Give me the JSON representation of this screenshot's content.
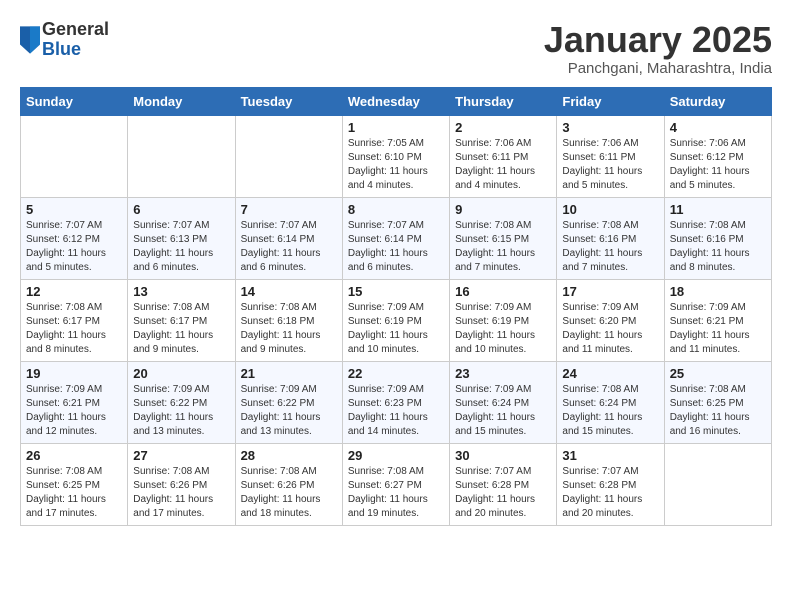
{
  "header": {
    "logo": {
      "general": "General",
      "blue": "Blue"
    },
    "title": "January 2025",
    "subtitle": "Panchgani, Maharashtra, India"
  },
  "weekdays": [
    "Sunday",
    "Monday",
    "Tuesday",
    "Wednesday",
    "Thursday",
    "Friday",
    "Saturday"
  ],
  "weeks": [
    [
      {
        "day": "",
        "info": ""
      },
      {
        "day": "",
        "info": ""
      },
      {
        "day": "",
        "info": ""
      },
      {
        "day": "1",
        "info": "Sunrise: 7:05 AM\nSunset: 6:10 PM\nDaylight: 11 hours\nand 4 minutes."
      },
      {
        "day": "2",
        "info": "Sunrise: 7:06 AM\nSunset: 6:11 PM\nDaylight: 11 hours\nand 4 minutes."
      },
      {
        "day": "3",
        "info": "Sunrise: 7:06 AM\nSunset: 6:11 PM\nDaylight: 11 hours\nand 5 minutes."
      },
      {
        "day": "4",
        "info": "Sunrise: 7:06 AM\nSunset: 6:12 PM\nDaylight: 11 hours\nand 5 minutes."
      }
    ],
    [
      {
        "day": "5",
        "info": "Sunrise: 7:07 AM\nSunset: 6:12 PM\nDaylight: 11 hours\nand 5 minutes."
      },
      {
        "day": "6",
        "info": "Sunrise: 7:07 AM\nSunset: 6:13 PM\nDaylight: 11 hours\nand 6 minutes."
      },
      {
        "day": "7",
        "info": "Sunrise: 7:07 AM\nSunset: 6:14 PM\nDaylight: 11 hours\nand 6 minutes."
      },
      {
        "day": "8",
        "info": "Sunrise: 7:07 AM\nSunset: 6:14 PM\nDaylight: 11 hours\nand 6 minutes."
      },
      {
        "day": "9",
        "info": "Sunrise: 7:08 AM\nSunset: 6:15 PM\nDaylight: 11 hours\nand 7 minutes."
      },
      {
        "day": "10",
        "info": "Sunrise: 7:08 AM\nSunset: 6:16 PM\nDaylight: 11 hours\nand 7 minutes."
      },
      {
        "day": "11",
        "info": "Sunrise: 7:08 AM\nSunset: 6:16 PM\nDaylight: 11 hours\nand 8 minutes."
      }
    ],
    [
      {
        "day": "12",
        "info": "Sunrise: 7:08 AM\nSunset: 6:17 PM\nDaylight: 11 hours\nand 8 minutes."
      },
      {
        "day": "13",
        "info": "Sunrise: 7:08 AM\nSunset: 6:17 PM\nDaylight: 11 hours\nand 9 minutes."
      },
      {
        "day": "14",
        "info": "Sunrise: 7:08 AM\nSunset: 6:18 PM\nDaylight: 11 hours\nand 9 minutes."
      },
      {
        "day": "15",
        "info": "Sunrise: 7:09 AM\nSunset: 6:19 PM\nDaylight: 11 hours\nand 10 minutes."
      },
      {
        "day": "16",
        "info": "Sunrise: 7:09 AM\nSunset: 6:19 PM\nDaylight: 11 hours\nand 10 minutes."
      },
      {
        "day": "17",
        "info": "Sunrise: 7:09 AM\nSunset: 6:20 PM\nDaylight: 11 hours\nand 11 minutes."
      },
      {
        "day": "18",
        "info": "Sunrise: 7:09 AM\nSunset: 6:21 PM\nDaylight: 11 hours\nand 11 minutes."
      }
    ],
    [
      {
        "day": "19",
        "info": "Sunrise: 7:09 AM\nSunset: 6:21 PM\nDaylight: 11 hours\nand 12 minutes."
      },
      {
        "day": "20",
        "info": "Sunrise: 7:09 AM\nSunset: 6:22 PM\nDaylight: 11 hours\nand 13 minutes."
      },
      {
        "day": "21",
        "info": "Sunrise: 7:09 AM\nSunset: 6:22 PM\nDaylight: 11 hours\nand 13 minutes."
      },
      {
        "day": "22",
        "info": "Sunrise: 7:09 AM\nSunset: 6:23 PM\nDaylight: 11 hours\nand 14 minutes."
      },
      {
        "day": "23",
        "info": "Sunrise: 7:09 AM\nSunset: 6:24 PM\nDaylight: 11 hours\nand 15 minutes."
      },
      {
        "day": "24",
        "info": "Sunrise: 7:08 AM\nSunset: 6:24 PM\nDaylight: 11 hours\nand 15 minutes."
      },
      {
        "day": "25",
        "info": "Sunrise: 7:08 AM\nSunset: 6:25 PM\nDaylight: 11 hours\nand 16 minutes."
      }
    ],
    [
      {
        "day": "26",
        "info": "Sunrise: 7:08 AM\nSunset: 6:25 PM\nDaylight: 11 hours\nand 17 minutes."
      },
      {
        "day": "27",
        "info": "Sunrise: 7:08 AM\nSunset: 6:26 PM\nDaylight: 11 hours\nand 17 minutes."
      },
      {
        "day": "28",
        "info": "Sunrise: 7:08 AM\nSunset: 6:26 PM\nDaylight: 11 hours\nand 18 minutes."
      },
      {
        "day": "29",
        "info": "Sunrise: 7:08 AM\nSunset: 6:27 PM\nDaylight: 11 hours\nand 19 minutes."
      },
      {
        "day": "30",
        "info": "Sunrise: 7:07 AM\nSunset: 6:28 PM\nDaylight: 11 hours\nand 20 minutes."
      },
      {
        "day": "31",
        "info": "Sunrise: 7:07 AM\nSunset: 6:28 PM\nDaylight: 11 hours\nand 20 minutes."
      },
      {
        "day": "",
        "info": ""
      }
    ]
  ]
}
